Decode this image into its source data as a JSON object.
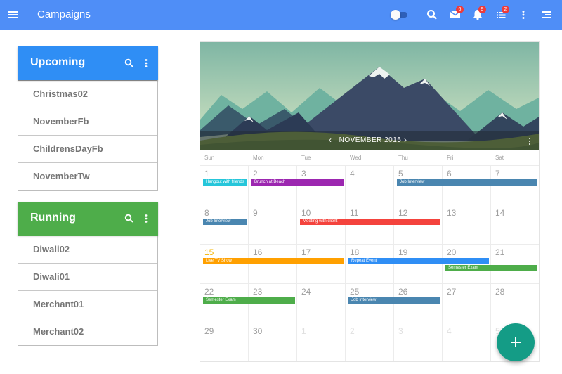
{
  "appbar": {
    "title": "Campaigns",
    "color": "#4f8ef7",
    "toggle_on": false,
    "badges": {
      "mail": "6",
      "notifications": "9",
      "list": "2"
    }
  },
  "upcoming": {
    "title": "Upcoming",
    "color": "#2f8ef5",
    "items": [
      "Christmas02",
      "NovemberFb",
      "ChildrensDayFb",
      "NovemberTw"
    ]
  },
  "running": {
    "title": "Running",
    "color": "#4ead4a",
    "items": [
      "Diwali02",
      "Diwali01",
      "Merchant01",
      "Merchant02"
    ]
  },
  "calendar": {
    "month": "NOVEMBER 2015",
    "weekdays": [
      "Sun",
      "Mon",
      "Tue",
      "Wed",
      "Thu",
      "Fri",
      "Sat"
    ],
    "weeks": [
      [
        "1",
        "2",
        "3",
        "4",
        "5",
        "6",
        "7"
      ],
      [
        "8",
        "9",
        "10",
        "11",
        "12",
        "13",
        "14"
      ],
      [
        "15",
        "16",
        "17",
        "18",
        "19",
        "20",
        "21"
      ],
      [
        "22",
        "23",
        "24",
        "25",
        "26",
        "27",
        "28"
      ],
      [
        "29",
        "30",
        "1",
        "2",
        "3",
        "4",
        "5"
      ]
    ],
    "today": "15",
    "events": [
      {
        "title": "Hangout with friends",
        "start_date": "2015-11-01",
        "end_date": "2015-11-01",
        "color": "#26c6da"
      },
      {
        "title": "Brunch at Beach",
        "start_date": "2015-11-02",
        "end_date": "2015-11-03",
        "color": "#9c27b0"
      },
      {
        "title": "Job Interview",
        "start_date": "2015-11-05",
        "end_date": "2015-11-07",
        "color": "#4a86b0"
      },
      {
        "title": "Job Interview",
        "start_date": "2015-11-08",
        "end_date": "2015-11-08",
        "color": "#4a86b0"
      },
      {
        "title": "Meeting with client",
        "start_date": "2015-11-10",
        "end_date": "2015-11-12",
        "color": "#f4433d"
      },
      {
        "title": "Live TV Show",
        "start_date": "2015-11-15",
        "end_date": "2015-11-17",
        "color": "#ffa000"
      },
      {
        "title": "Repeat Event",
        "start_date": "2015-11-18",
        "end_date": "2015-11-20",
        "color": "#2f8ef5"
      },
      {
        "title": "Semester Exam",
        "start_date": "2015-11-20",
        "end_date": "2015-11-21",
        "color": "#4ead4a"
      },
      {
        "title": "Semester Exam",
        "start_date": "2015-11-22",
        "end_date": "2015-11-23",
        "color": "#4ead4a"
      },
      {
        "title": "Job Interview",
        "start_date": "2015-11-25",
        "end_date": "2015-11-26",
        "color": "#4a86b0"
      }
    ]
  },
  "fab": {
    "icon": "plus-icon",
    "color": "#149c86"
  }
}
